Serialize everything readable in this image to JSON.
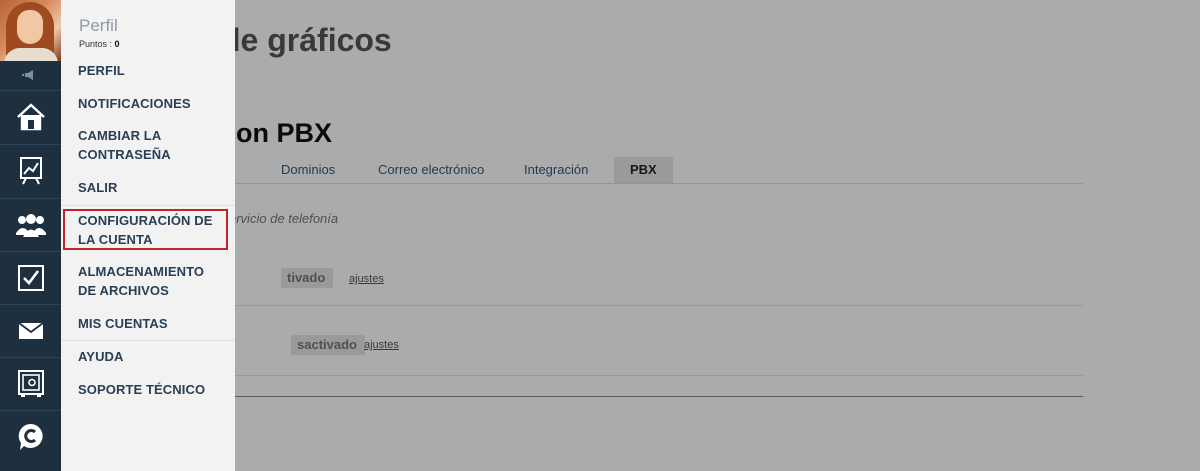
{
  "background": {
    "title": "de gráficos",
    "subtitle": "con PBX",
    "tabs": [
      {
        "label": "Dominios"
      },
      {
        "label": "Correo electrónico"
      },
      {
        "label": "Integración"
      },
      {
        "label": "PBX",
        "active": true
      }
    ],
    "description": "ervicio de telefonía",
    "rows": [
      {
        "status": "tivado",
        "link": "ajustes"
      },
      {
        "status": "sactivado",
        "link": "ajustes"
      }
    ]
  },
  "menu": {
    "title": "Perfil",
    "points_label": "Puntos :",
    "points_value": "0",
    "items": [
      {
        "label": "PERFIL"
      },
      {
        "label": "NOTIFICACIONES"
      },
      {
        "label": "CAMBIAR LA CONTRASEÑA"
      },
      {
        "label": "SALIR"
      },
      {
        "label": "CONFIGURACIÓN DE LA CUENTA",
        "highlighted": true
      },
      {
        "label": "ALMACENAMIENTO DE ARCHIVOS"
      },
      {
        "label": "MIS CUENTAS"
      },
      {
        "label": "AYUDA"
      },
      {
        "label": "SOPORTE TÉCNICO"
      }
    ]
  },
  "sidebar": {
    "icons": [
      "speaker-icon",
      "home-icon",
      "chart-icon",
      "contacts-icon",
      "tasks-icon",
      "mail-icon",
      "safe-icon",
      "chat-icon"
    ]
  },
  "colors": {
    "rail": "#1e2f40",
    "menu_bg": "#f2f2f2",
    "menu_text": "#2a3f55",
    "highlight": "#c0252a"
  }
}
